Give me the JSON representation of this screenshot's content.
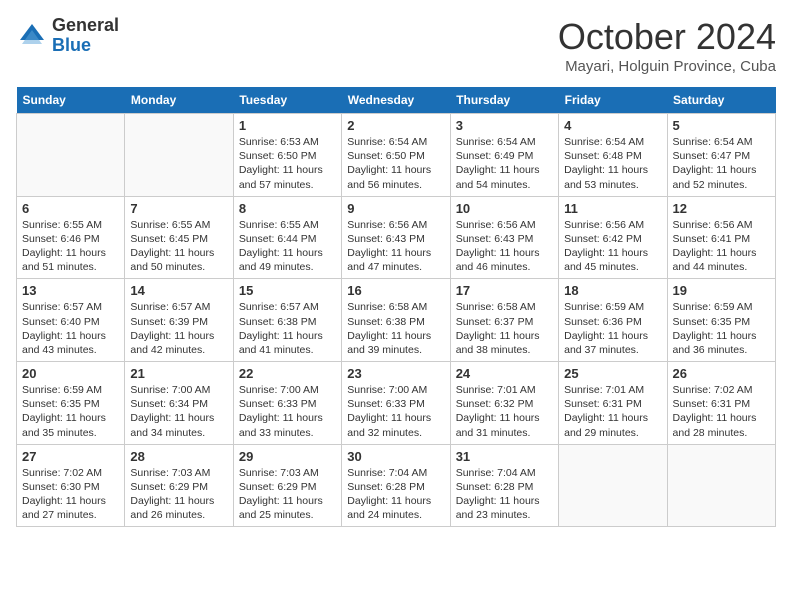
{
  "logo": {
    "general": "General",
    "blue": "Blue"
  },
  "title": "October 2024",
  "location": "Mayari, Holguin Province, Cuba",
  "days_of_week": [
    "Sunday",
    "Monday",
    "Tuesday",
    "Wednesday",
    "Thursday",
    "Friday",
    "Saturday"
  ],
  "weeks": [
    [
      {
        "day": "",
        "sunrise": "",
        "sunset": "",
        "daylight": ""
      },
      {
        "day": "",
        "sunrise": "",
        "sunset": "",
        "daylight": ""
      },
      {
        "day": "1",
        "sunrise": "Sunrise: 6:53 AM",
        "sunset": "Sunset: 6:50 PM",
        "daylight": "Daylight: 11 hours and 57 minutes."
      },
      {
        "day": "2",
        "sunrise": "Sunrise: 6:54 AM",
        "sunset": "Sunset: 6:50 PM",
        "daylight": "Daylight: 11 hours and 56 minutes."
      },
      {
        "day": "3",
        "sunrise": "Sunrise: 6:54 AM",
        "sunset": "Sunset: 6:49 PM",
        "daylight": "Daylight: 11 hours and 54 minutes."
      },
      {
        "day": "4",
        "sunrise": "Sunrise: 6:54 AM",
        "sunset": "Sunset: 6:48 PM",
        "daylight": "Daylight: 11 hours and 53 minutes."
      },
      {
        "day": "5",
        "sunrise": "Sunrise: 6:54 AM",
        "sunset": "Sunset: 6:47 PM",
        "daylight": "Daylight: 11 hours and 52 minutes."
      }
    ],
    [
      {
        "day": "6",
        "sunrise": "Sunrise: 6:55 AM",
        "sunset": "Sunset: 6:46 PM",
        "daylight": "Daylight: 11 hours and 51 minutes."
      },
      {
        "day": "7",
        "sunrise": "Sunrise: 6:55 AM",
        "sunset": "Sunset: 6:45 PM",
        "daylight": "Daylight: 11 hours and 50 minutes."
      },
      {
        "day": "8",
        "sunrise": "Sunrise: 6:55 AM",
        "sunset": "Sunset: 6:44 PM",
        "daylight": "Daylight: 11 hours and 49 minutes."
      },
      {
        "day": "9",
        "sunrise": "Sunrise: 6:56 AM",
        "sunset": "Sunset: 6:43 PM",
        "daylight": "Daylight: 11 hours and 47 minutes."
      },
      {
        "day": "10",
        "sunrise": "Sunrise: 6:56 AM",
        "sunset": "Sunset: 6:43 PM",
        "daylight": "Daylight: 11 hours and 46 minutes."
      },
      {
        "day": "11",
        "sunrise": "Sunrise: 6:56 AM",
        "sunset": "Sunset: 6:42 PM",
        "daylight": "Daylight: 11 hours and 45 minutes."
      },
      {
        "day": "12",
        "sunrise": "Sunrise: 6:56 AM",
        "sunset": "Sunset: 6:41 PM",
        "daylight": "Daylight: 11 hours and 44 minutes."
      }
    ],
    [
      {
        "day": "13",
        "sunrise": "Sunrise: 6:57 AM",
        "sunset": "Sunset: 6:40 PM",
        "daylight": "Daylight: 11 hours and 43 minutes."
      },
      {
        "day": "14",
        "sunrise": "Sunrise: 6:57 AM",
        "sunset": "Sunset: 6:39 PM",
        "daylight": "Daylight: 11 hours and 42 minutes."
      },
      {
        "day": "15",
        "sunrise": "Sunrise: 6:57 AM",
        "sunset": "Sunset: 6:38 PM",
        "daylight": "Daylight: 11 hours and 41 minutes."
      },
      {
        "day": "16",
        "sunrise": "Sunrise: 6:58 AM",
        "sunset": "Sunset: 6:38 PM",
        "daylight": "Daylight: 11 hours and 39 minutes."
      },
      {
        "day": "17",
        "sunrise": "Sunrise: 6:58 AM",
        "sunset": "Sunset: 6:37 PM",
        "daylight": "Daylight: 11 hours and 38 minutes."
      },
      {
        "day": "18",
        "sunrise": "Sunrise: 6:59 AM",
        "sunset": "Sunset: 6:36 PM",
        "daylight": "Daylight: 11 hours and 37 minutes."
      },
      {
        "day": "19",
        "sunrise": "Sunrise: 6:59 AM",
        "sunset": "Sunset: 6:35 PM",
        "daylight": "Daylight: 11 hours and 36 minutes."
      }
    ],
    [
      {
        "day": "20",
        "sunrise": "Sunrise: 6:59 AM",
        "sunset": "Sunset: 6:35 PM",
        "daylight": "Daylight: 11 hours and 35 minutes."
      },
      {
        "day": "21",
        "sunrise": "Sunrise: 7:00 AM",
        "sunset": "Sunset: 6:34 PM",
        "daylight": "Daylight: 11 hours and 34 minutes."
      },
      {
        "day": "22",
        "sunrise": "Sunrise: 7:00 AM",
        "sunset": "Sunset: 6:33 PM",
        "daylight": "Daylight: 11 hours and 33 minutes."
      },
      {
        "day": "23",
        "sunrise": "Sunrise: 7:00 AM",
        "sunset": "Sunset: 6:33 PM",
        "daylight": "Daylight: 11 hours and 32 minutes."
      },
      {
        "day": "24",
        "sunrise": "Sunrise: 7:01 AM",
        "sunset": "Sunset: 6:32 PM",
        "daylight": "Daylight: 11 hours and 31 minutes."
      },
      {
        "day": "25",
        "sunrise": "Sunrise: 7:01 AM",
        "sunset": "Sunset: 6:31 PM",
        "daylight": "Daylight: 11 hours and 29 minutes."
      },
      {
        "day": "26",
        "sunrise": "Sunrise: 7:02 AM",
        "sunset": "Sunset: 6:31 PM",
        "daylight": "Daylight: 11 hours and 28 minutes."
      }
    ],
    [
      {
        "day": "27",
        "sunrise": "Sunrise: 7:02 AM",
        "sunset": "Sunset: 6:30 PM",
        "daylight": "Daylight: 11 hours and 27 minutes."
      },
      {
        "day": "28",
        "sunrise": "Sunrise: 7:03 AM",
        "sunset": "Sunset: 6:29 PM",
        "daylight": "Daylight: 11 hours and 26 minutes."
      },
      {
        "day": "29",
        "sunrise": "Sunrise: 7:03 AM",
        "sunset": "Sunset: 6:29 PM",
        "daylight": "Daylight: 11 hours and 25 minutes."
      },
      {
        "day": "30",
        "sunrise": "Sunrise: 7:04 AM",
        "sunset": "Sunset: 6:28 PM",
        "daylight": "Daylight: 11 hours and 24 minutes."
      },
      {
        "day": "31",
        "sunrise": "Sunrise: 7:04 AM",
        "sunset": "Sunset: 6:28 PM",
        "daylight": "Daylight: 11 hours and 23 minutes."
      },
      {
        "day": "",
        "sunrise": "",
        "sunset": "",
        "daylight": ""
      },
      {
        "day": "",
        "sunrise": "",
        "sunset": "",
        "daylight": ""
      }
    ]
  ]
}
